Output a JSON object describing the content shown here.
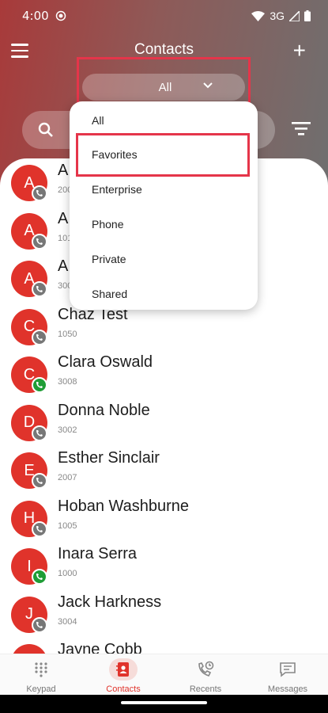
{
  "status_bar": {
    "time": "4:00",
    "network": "3G"
  },
  "header": {
    "title": "Contacts",
    "add_label": "+"
  },
  "filter": {
    "selected": "All",
    "options": [
      "All",
      "Favorites",
      "Enterprise",
      "Phone",
      "Private",
      "Shared"
    ],
    "highlighted_option": "Favorites"
  },
  "contacts": [
    {
      "initial": "A",
      "name": "A",
      "ext": "200",
      "status": "gray"
    },
    {
      "initial": "A",
      "name": "A",
      "ext": "101",
      "status": "gray"
    },
    {
      "initial": "A",
      "name": "A",
      "ext": "300",
      "status": "gray"
    },
    {
      "initial": "C",
      "name": "Chaz Test",
      "ext": "1050",
      "status": "gray"
    },
    {
      "initial": "C",
      "name": "Clara Oswald",
      "ext": "3008",
      "status": "green"
    },
    {
      "initial": "D",
      "name": "Donna Noble",
      "ext": "3002",
      "status": "gray"
    },
    {
      "initial": "E",
      "name": "Esther Sinclair",
      "ext": "2007",
      "status": "gray"
    },
    {
      "initial": "H",
      "name": "Hoban Washburne",
      "ext": "1005",
      "status": "gray"
    },
    {
      "initial": "I",
      "name": "Inara Serra",
      "ext": "1000",
      "status": "green"
    },
    {
      "initial": "J",
      "name": "Jack Harkness",
      "ext": "3004",
      "status": "gray"
    },
    {
      "initial": "J",
      "name": "Jayne Cobb",
      "ext": "",
      "status": "gray"
    }
  ],
  "bottom_nav": [
    {
      "label": "Keypad",
      "icon": "keypad-icon",
      "active": false
    },
    {
      "label": "Contacts",
      "icon": "contacts-icon",
      "active": true
    },
    {
      "label": "Recents",
      "icon": "recents-icon",
      "active": false
    },
    {
      "label": "Messages",
      "icon": "messages-icon",
      "active": false
    }
  ],
  "colors": {
    "accent": "#e0332b",
    "highlight_border": "#e5354a",
    "online_badge": "#1f9d36"
  }
}
